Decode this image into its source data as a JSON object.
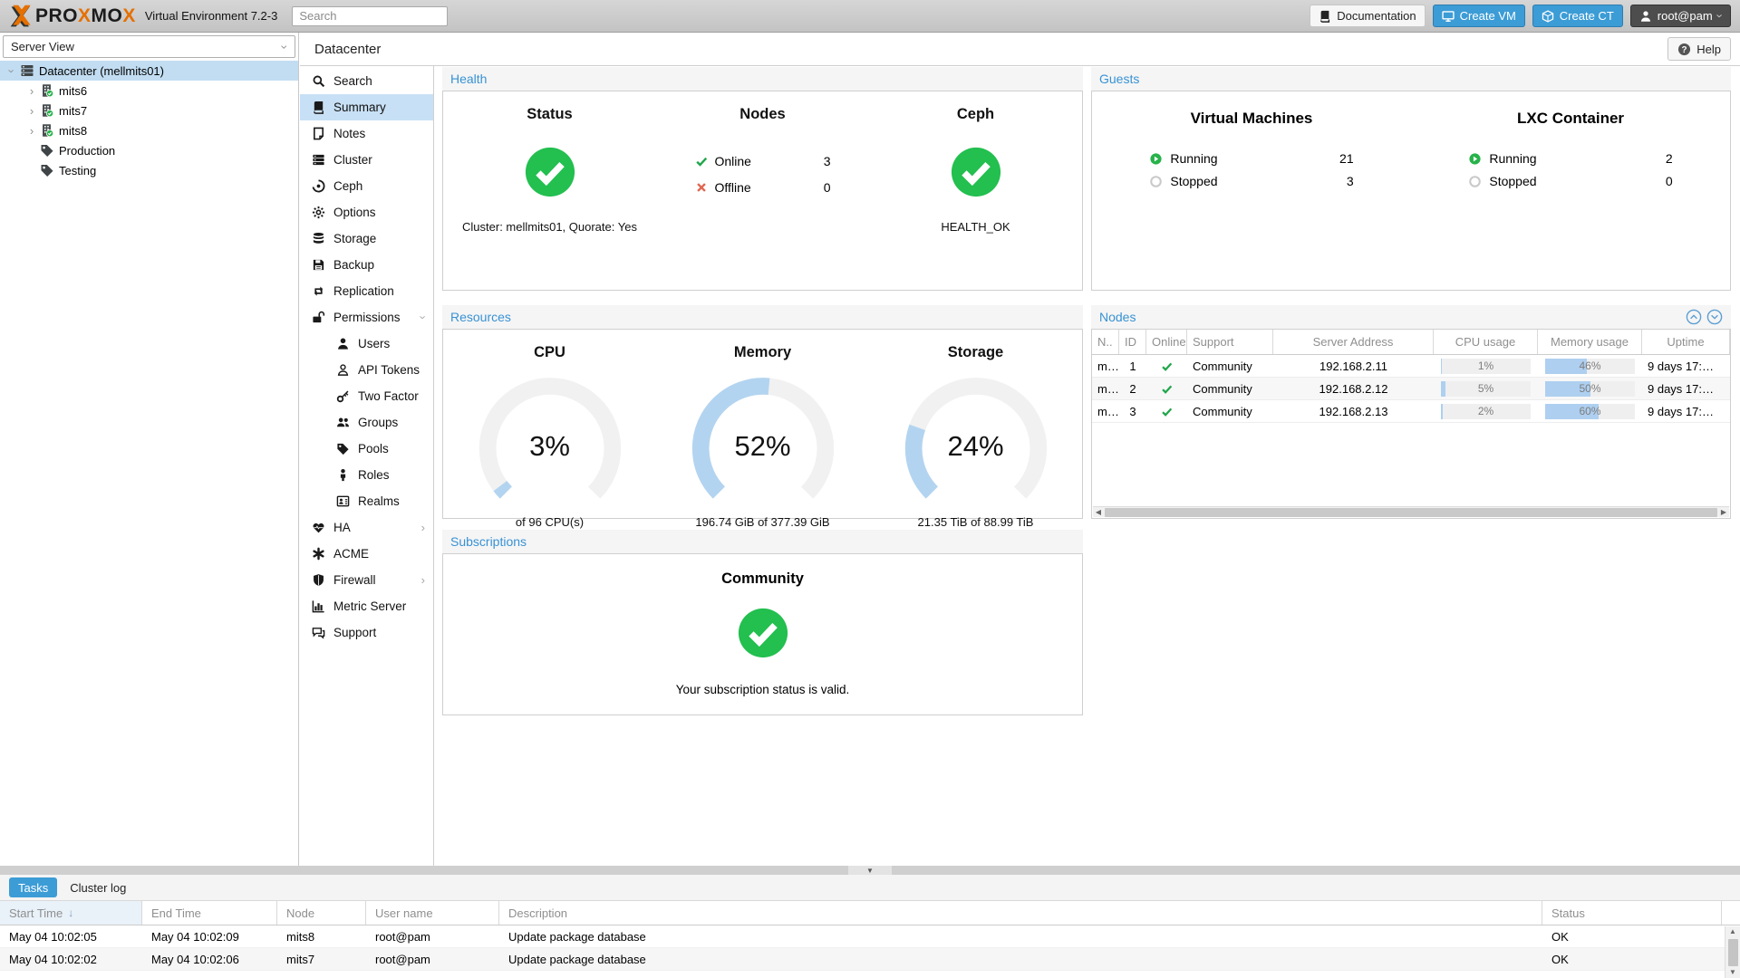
{
  "topbar": {
    "brand": {
      "p1": "PRO",
      "x1": "X",
      "p2": "MO",
      "x2": "X"
    },
    "subtitle": "Virtual Environment 7.2-3",
    "search_placeholder": "Search",
    "documentation": "Documentation",
    "create_vm": "Create VM",
    "create_ct": "Create CT",
    "user": "root@pam"
  },
  "tree": {
    "view_selector": "Server View",
    "items": [
      {
        "label": "Datacenter (mellmits01)"
      },
      {
        "label": "mits6"
      },
      {
        "label": "mits7"
      },
      {
        "label": "mits8"
      },
      {
        "label": "Production"
      },
      {
        "label": "Testing"
      }
    ]
  },
  "content_header": {
    "title": "Datacenter",
    "help": "Help"
  },
  "sidebar": {
    "items": [
      {
        "label": "Search"
      },
      {
        "label": "Summary"
      },
      {
        "label": "Notes"
      },
      {
        "label": "Cluster"
      },
      {
        "label": "Ceph"
      },
      {
        "label": "Options"
      },
      {
        "label": "Storage"
      },
      {
        "label": "Backup"
      },
      {
        "label": "Replication"
      },
      {
        "label": "Permissions"
      },
      {
        "label": "Users"
      },
      {
        "label": "API Tokens"
      },
      {
        "label": "Two Factor"
      },
      {
        "label": "Groups"
      },
      {
        "label": "Pools"
      },
      {
        "label": "Roles"
      },
      {
        "label": "Realms"
      },
      {
        "label": "HA"
      },
      {
        "label": "ACME"
      },
      {
        "label": "Firewall"
      },
      {
        "label": "Metric Server"
      },
      {
        "label": "Support"
      }
    ]
  },
  "health": {
    "title": "Health",
    "status_heading": "Status",
    "status_footer": "Cluster: mellmits01, Quorate: Yes",
    "nodes_heading": "Nodes",
    "online_label": "Online",
    "online_value": "3",
    "offline_label": "Offline",
    "offline_value": "0",
    "ceph_heading": "Ceph",
    "ceph_status": "HEALTH_OK"
  },
  "guests": {
    "title": "Guests",
    "vm_heading": "Virtual Machines",
    "lxc_heading": "LXC Container",
    "running_label": "Running",
    "stopped_label": "Stopped",
    "vm_running": "21",
    "vm_stopped": "3",
    "lxc_running": "2",
    "lxc_stopped": "0"
  },
  "resources": {
    "title": "Resources",
    "gauges": [
      {
        "heading": "CPU",
        "pct": 3,
        "pct_label": "3%",
        "sub": "of 96 CPU(s)"
      },
      {
        "heading": "Memory",
        "pct": 52,
        "pct_label": "52%",
        "sub": "196.74 GiB of 377.39 GiB"
      },
      {
        "heading": "Storage",
        "pct": 24,
        "pct_label": "24%",
        "sub": "21.35 TiB of 88.99 TiB"
      }
    ]
  },
  "nodes_panel": {
    "title": "Nodes",
    "columns": [
      "N..",
      "ID",
      "Online",
      "Support",
      "Server Address",
      "CPU usage",
      "Memory usage",
      "Uptime"
    ],
    "rows": [
      {
        "name": "m…",
        "id": "1",
        "support": "Community",
        "addr": "192.168.2.11",
        "cpu": 1,
        "cpu_label": "1%",
        "mem": 46,
        "mem_label": "46%",
        "uptime": "9 days 17:…"
      },
      {
        "name": "m…",
        "id": "2",
        "support": "Community",
        "addr": "192.168.2.12",
        "cpu": 5,
        "cpu_label": "5%",
        "mem": 50,
        "mem_label": "50%",
        "uptime": "9 days 17:…"
      },
      {
        "name": "m…",
        "id": "3",
        "support": "Community",
        "addr": "192.168.2.13",
        "cpu": 2,
        "cpu_label": "2%",
        "mem": 60,
        "mem_label": "60%",
        "uptime": "9 days 17:…"
      }
    ]
  },
  "subscriptions": {
    "title": "Subscriptions",
    "level": "Community",
    "message": "Your subscription status is valid."
  },
  "tasks": {
    "tab_tasks": "Tasks",
    "tab_cluster_log": "Cluster log",
    "columns": [
      "Start Time",
      "End Time",
      "Node",
      "User name",
      "Description",
      "Status"
    ],
    "rows": [
      {
        "start": "May 04 10:02:05",
        "end": "May 04 10:02:09",
        "node": "mits8",
        "user": "root@pam",
        "desc": "Update package database",
        "status": "OK"
      },
      {
        "start": "May 04 10:02:02",
        "end": "May 04 10:02:06",
        "node": "mits7",
        "user": "root@pam",
        "desc": "Update package database",
        "status": "OK"
      }
    ]
  },
  "icons": {
    "names": [
      "proxmox-logo-icon",
      "search-icon",
      "book-icon",
      "note-icon",
      "cluster-icon",
      "ceph-icon",
      "gear-icon",
      "database-icon",
      "floppy-icon",
      "replication-icon",
      "unlock-icon",
      "user-icon",
      "user-outline-icon",
      "key-icon",
      "users-icon",
      "tag-icon",
      "role-icon",
      "address-card-icon",
      "heart-icon",
      "asterisk-icon",
      "shield-icon",
      "bar-chart-icon",
      "chat-icon",
      "monitor-icon",
      "cube-icon",
      "help-icon",
      "check-icon",
      "cross-icon",
      "big-check-icon",
      "play-icon",
      "stop-ring-icon",
      "fold-up-icon",
      "fold-down-icon",
      "server-icon",
      "node-icon"
    ]
  }
}
